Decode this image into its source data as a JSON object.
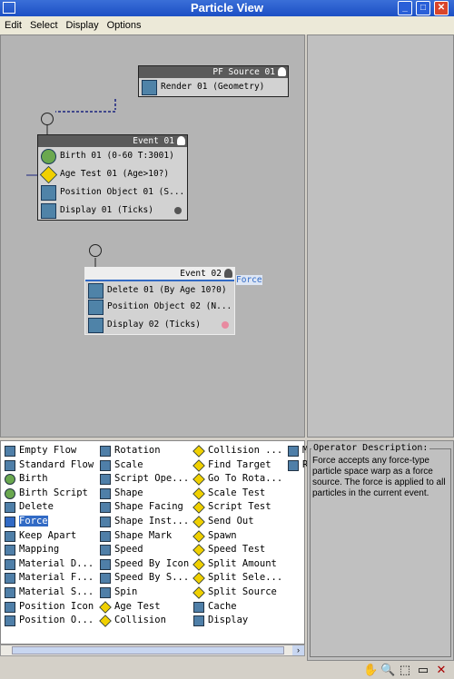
{
  "window": {
    "title": "Particle View"
  },
  "menu": [
    "Edit",
    "Select",
    "Display",
    "Options"
  ],
  "graph": {
    "source": {
      "title": "PF Source 01",
      "rows": [
        {
          "label": "Render 01 (Geometry)",
          "icon": "render-icon"
        }
      ]
    },
    "event1": {
      "title": "Event 01",
      "rows": [
        {
          "label": "Birth 01 (0-60 T:3001)",
          "icon": "birth-icon"
        },
        {
          "label": "Age Test 01 (Age>10?)",
          "icon": "test-icon"
        },
        {
          "label": "Position Object 01 (S...",
          "icon": "position-icon"
        },
        {
          "label": "Display 01 (Ticks)",
          "icon": "display-icon"
        }
      ],
      "display_color": "#555555"
    },
    "event2": {
      "title": "Event 02",
      "rows": [
        {
          "label": "Delete 01 (By Age 10?0)",
          "icon": "delete-icon"
        },
        {
          "label": "Position Object 02 (N...",
          "icon": "position-icon"
        },
        {
          "label": "Display 02 (Ticks)",
          "icon": "display-icon"
        }
      ],
      "display_color": "#e88aa0"
    },
    "drag_label": "Force"
  },
  "depot": {
    "columns": [
      [
        "Empty Flow",
        "Standard Flow",
        "Birth",
        "Birth Script",
        "Delete",
        "Force",
        "Keep Apart",
        "Mapping",
        "Material D...",
        "Material F...",
        "Material S...",
        "Position Icon",
        "Position O..."
      ],
      [
        "Rotation",
        "Scale",
        "Script Ope...",
        "Shape",
        "Shape Facing",
        "Shape Inst...",
        "Shape Mark",
        "Speed",
        "Speed By Icon",
        "Speed By S...",
        "Spin",
        "Age Test",
        "Collision"
      ],
      [
        "Collision ...",
        "Find Target",
        "Go To Rota...",
        "Scale Test",
        "Script Test",
        "Send Out",
        "Spawn",
        "Speed Test",
        "Split Amount",
        "Split Sele...",
        "Split Source",
        "Cache",
        "Display"
      ],
      [
        "M",
        "R"
      ]
    ],
    "selected": "Force"
  },
  "description": {
    "label": "Operator Description:",
    "text": "Force accepts any force-type particle space warp as a force source. The force is applied to all particles in the current event."
  },
  "status_tools": [
    "pan-icon",
    "zoom-icon",
    "zoom-region-icon",
    "zoom-extents-icon",
    "no-zoom-icon"
  ]
}
